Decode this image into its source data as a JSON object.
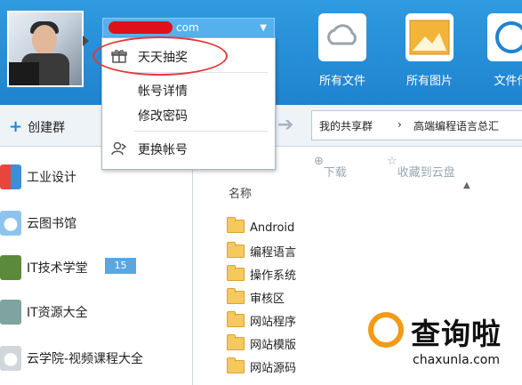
{
  "header": {
    "account_email_suffix": "com",
    "top_icons": [
      {
        "label": "所有文件",
        "icon": "cloud-folder-icon"
      },
      {
        "label": "所有图片",
        "icon": "pictures-icon"
      },
      {
        "label": "文件传",
        "icon": "transfer-icon"
      }
    ]
  },
  "toolbar": {
    "create_group": "创建群",
    "breadcrumb": [
      "我的共享群",
      "高端编程语言总汇"
    ]
  },
  "menu": {
    "items": [
      {
        "label": "天天抽奖",
        "icon": "gift-icon"
      },
      {
        "label": "帐号详情"
      },
      {
        "label": "修改密码"
      },
      {
        "label": "更换帐号",
        "icon": "switch-account-icon"
      }
    ]
  },
  "sidebar": {
    "groups": [
      {
        "label": "工业设计"
      },
      {
        "label": "云图书馆"
      },
      {
        "label": "IT技术学堂",
        "badge": "15"
      },
      {
        "label": "IT资源大全"
      },
      {
        "label": "云学院-视频课程大全"
      }
    ]
  },
  "filepane": {
    "actions": [
      "下载",
      "收藏到云盘"
    ],
    "column_name": "名称",
    "files": [
      "Android",
      "编程语言",
      "操作系统",
      "审核区",
      "网站程序",
      "网站模版",
      "网站源码"
    ]
  },
  "watermark": {
    "brand": "查询啦",
    "url": "chaxunla.com"
  },
  "colors": {
    "header_blue": "#2f9be0",
    "highlight_red": "#e33a3a",
    "badge_blue": "#5aa6e0",
    "folder_yellow": "#f5c95c"
  }
}
